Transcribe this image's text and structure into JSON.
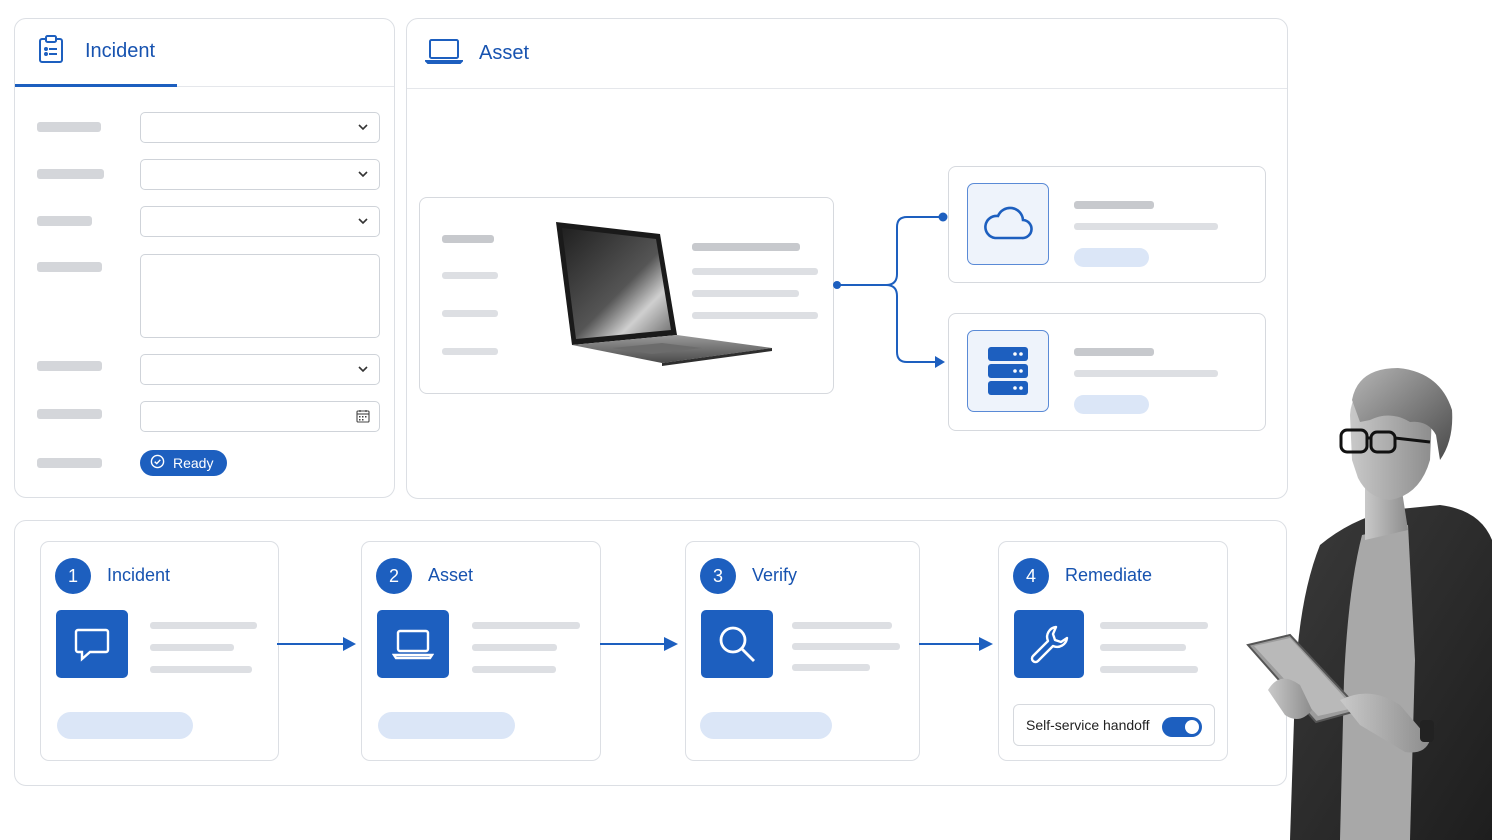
{
  "incident_panel": {
    "title": "Incident",
    "status_label": "Ready"
  },
  "asset_panel": {
    "title": "Asset"
  },
  "workflow": {
    "steps": [
      {
        "number": "1",
        "title": "Incident",
        "icon": "chat-bubble-icon"
      },
      {
        "number": "2",
        "title": "Asset",
        "icon": "laptop-icon"
      },
      {
        "number": "3",
        "title": "Verify",
        "icon": "search-icon"
      },
      {
        "number": "4",
        "title": "Remediate",
        "icon": "wrench-icon"
      }
    ],
    "toggle_label": "Self-service handoff",
    "toggle_on": true
  },
  "colors": {
    "accent": "#1d5fbf",
    "accent_light": "#dbe6f7"
  }
}
